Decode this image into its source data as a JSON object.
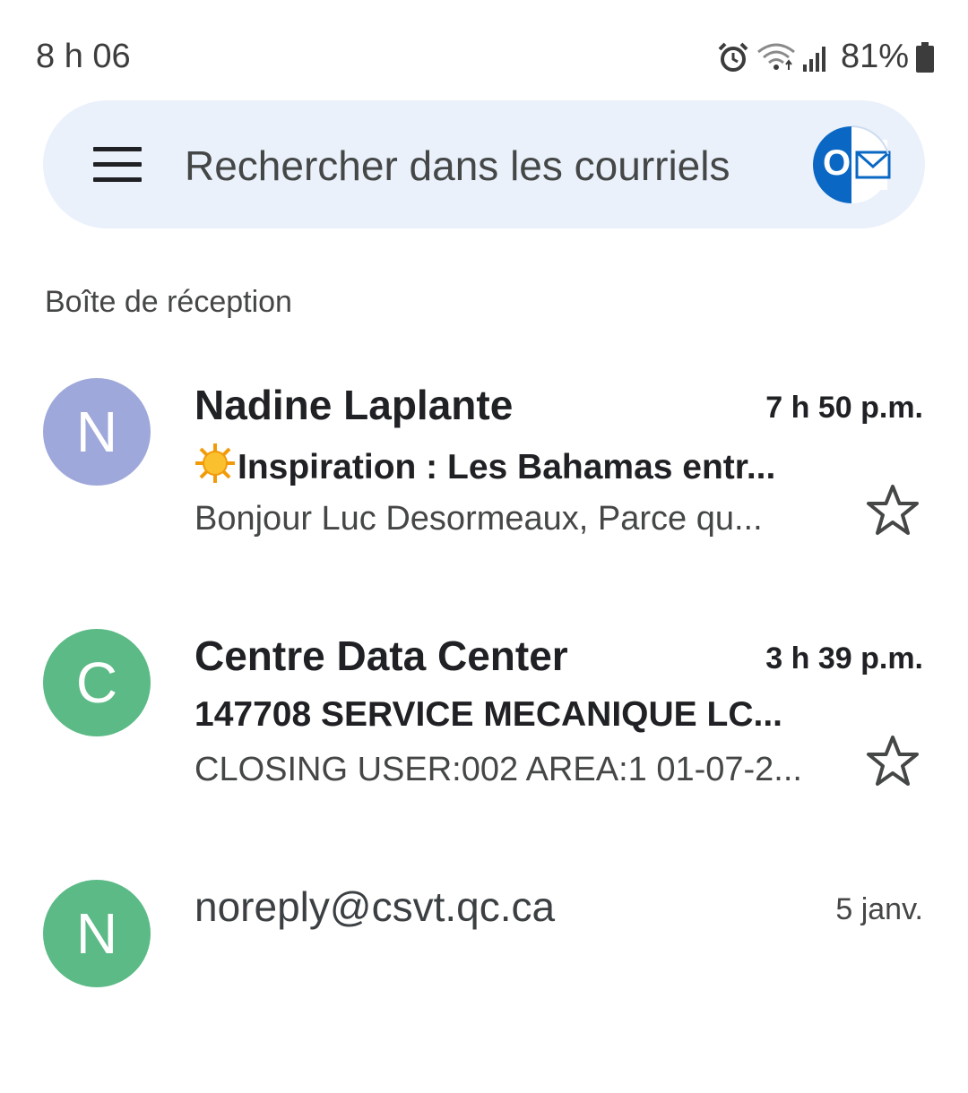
{
  "status_bar": {
    "time": "8 h 06",
    "battery": "81%",
    "icons": [
      "alarm-icon",
      "wifi-icon",
      "signal-icon",
      "battery-icon"
    ]
  },
  "search": {
    "placeholder": "Rechercher dans les courriels",
    "menu_icon": "hamburger-menu-icon",
    "account_icon": "outlook-account-icon",
    "account_letter": "O"
  },
  "section": {
    "title": "Boîte de réception"
  },
  "emails": [
    {
      "avatar_letter": "N",
      "avatar_color": "#9fa8da",
      "sender": "Nadine Laplante",
      "time": "7 h 50 p.m.",
      "subject_icon": "sun-emoji",
      "subject": "Inspiration : Les Bahamas entr...",
      "snippet": "Bonjour Luc Desormeaux, Parce qu...",
      "unread": true,
      "starred": false
    },
    {
      "avatar_letter": "C",
      "avatar_color": "#5bba85",
      "sender": "Centre Data Center",
      "time": "3 h 39 p.m.",
      "subject": "147708 SERVICE MECANIQUE LC...",
      "snippet": "CLOSING USER:002 AREA:1 01-07-2...",
      "unread": true,
      "starred": false
    },
    {
      "avatar_letter": "N",
      "avatar_color": "#5bba85",
      "sender": "noreply@csvt.qc.ca",
      "time": "5 janv.",
      "unread": false
    }
  ]
}
